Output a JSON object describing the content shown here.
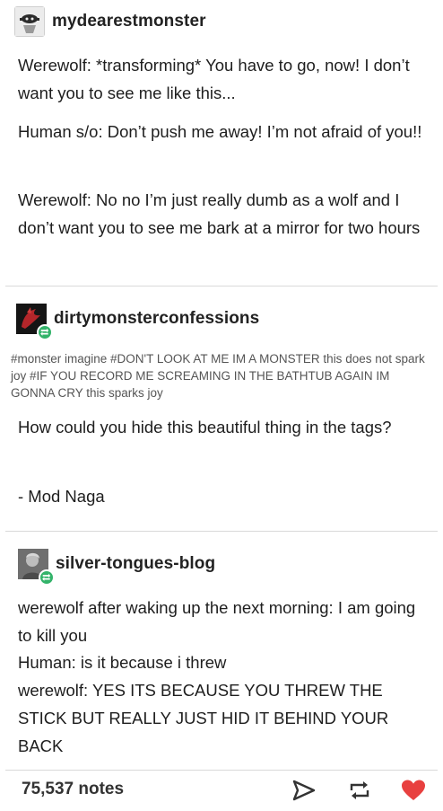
{
  "posts": [
    {
      "username": "mydearestmonster",
      "avatar": "mask-avatar",
      "paragraphs": [
        "Werewolf: *transforming* You have to go, now! I don’t want you to see me like this...",
        "Human s/o: Don’t push me away! I’m not afraid of you!!",
        "Werewolf: No no I’m just really dumb as a wolf and I don’t want you to see me bark at a mirror for two hours"
      ]
    },
    {
      "username": "dirtymonsterconfessions",
      "avatar": "dragon-avatar",
      "tags": "#monster imagine  #DON'T LOOK AT ME IM A MONSTER this does not spark joy  #IF YOU RECORD ME SCREAMING IN THE BATHTUB AGAIN IM GONNA CRY this sparks joy",
      "paragraphs": [
        "How could you hide this beautiful thing in the tags?",
        "- Mod Naga"
      ]
    },
    {
      "username": "silver-tongues-blog",
      "avatar": "portrait-avatar",
      "lines": [
        "werewolf after waking up the next morning: I am going to kill you",
        "Human: is it because i threw",
        "werewolf: YES ITS BECAUSE YOU THREW THE STICK BUT REALLY JUST HID IT BEHIND YOUR BACK"
      ]
    }
  ],
  "footer": {
    "notes": "75,537 notes",
    "icons": [
      "share-icon",
      "reblog-icon",
      "like-heart-icon"
    ],
    "heart_color": "#e8403f"
  },
  "colors": {
    "reblog_badge": "#33b36a",
    "divider": "#d9d9d9"
  }
}
